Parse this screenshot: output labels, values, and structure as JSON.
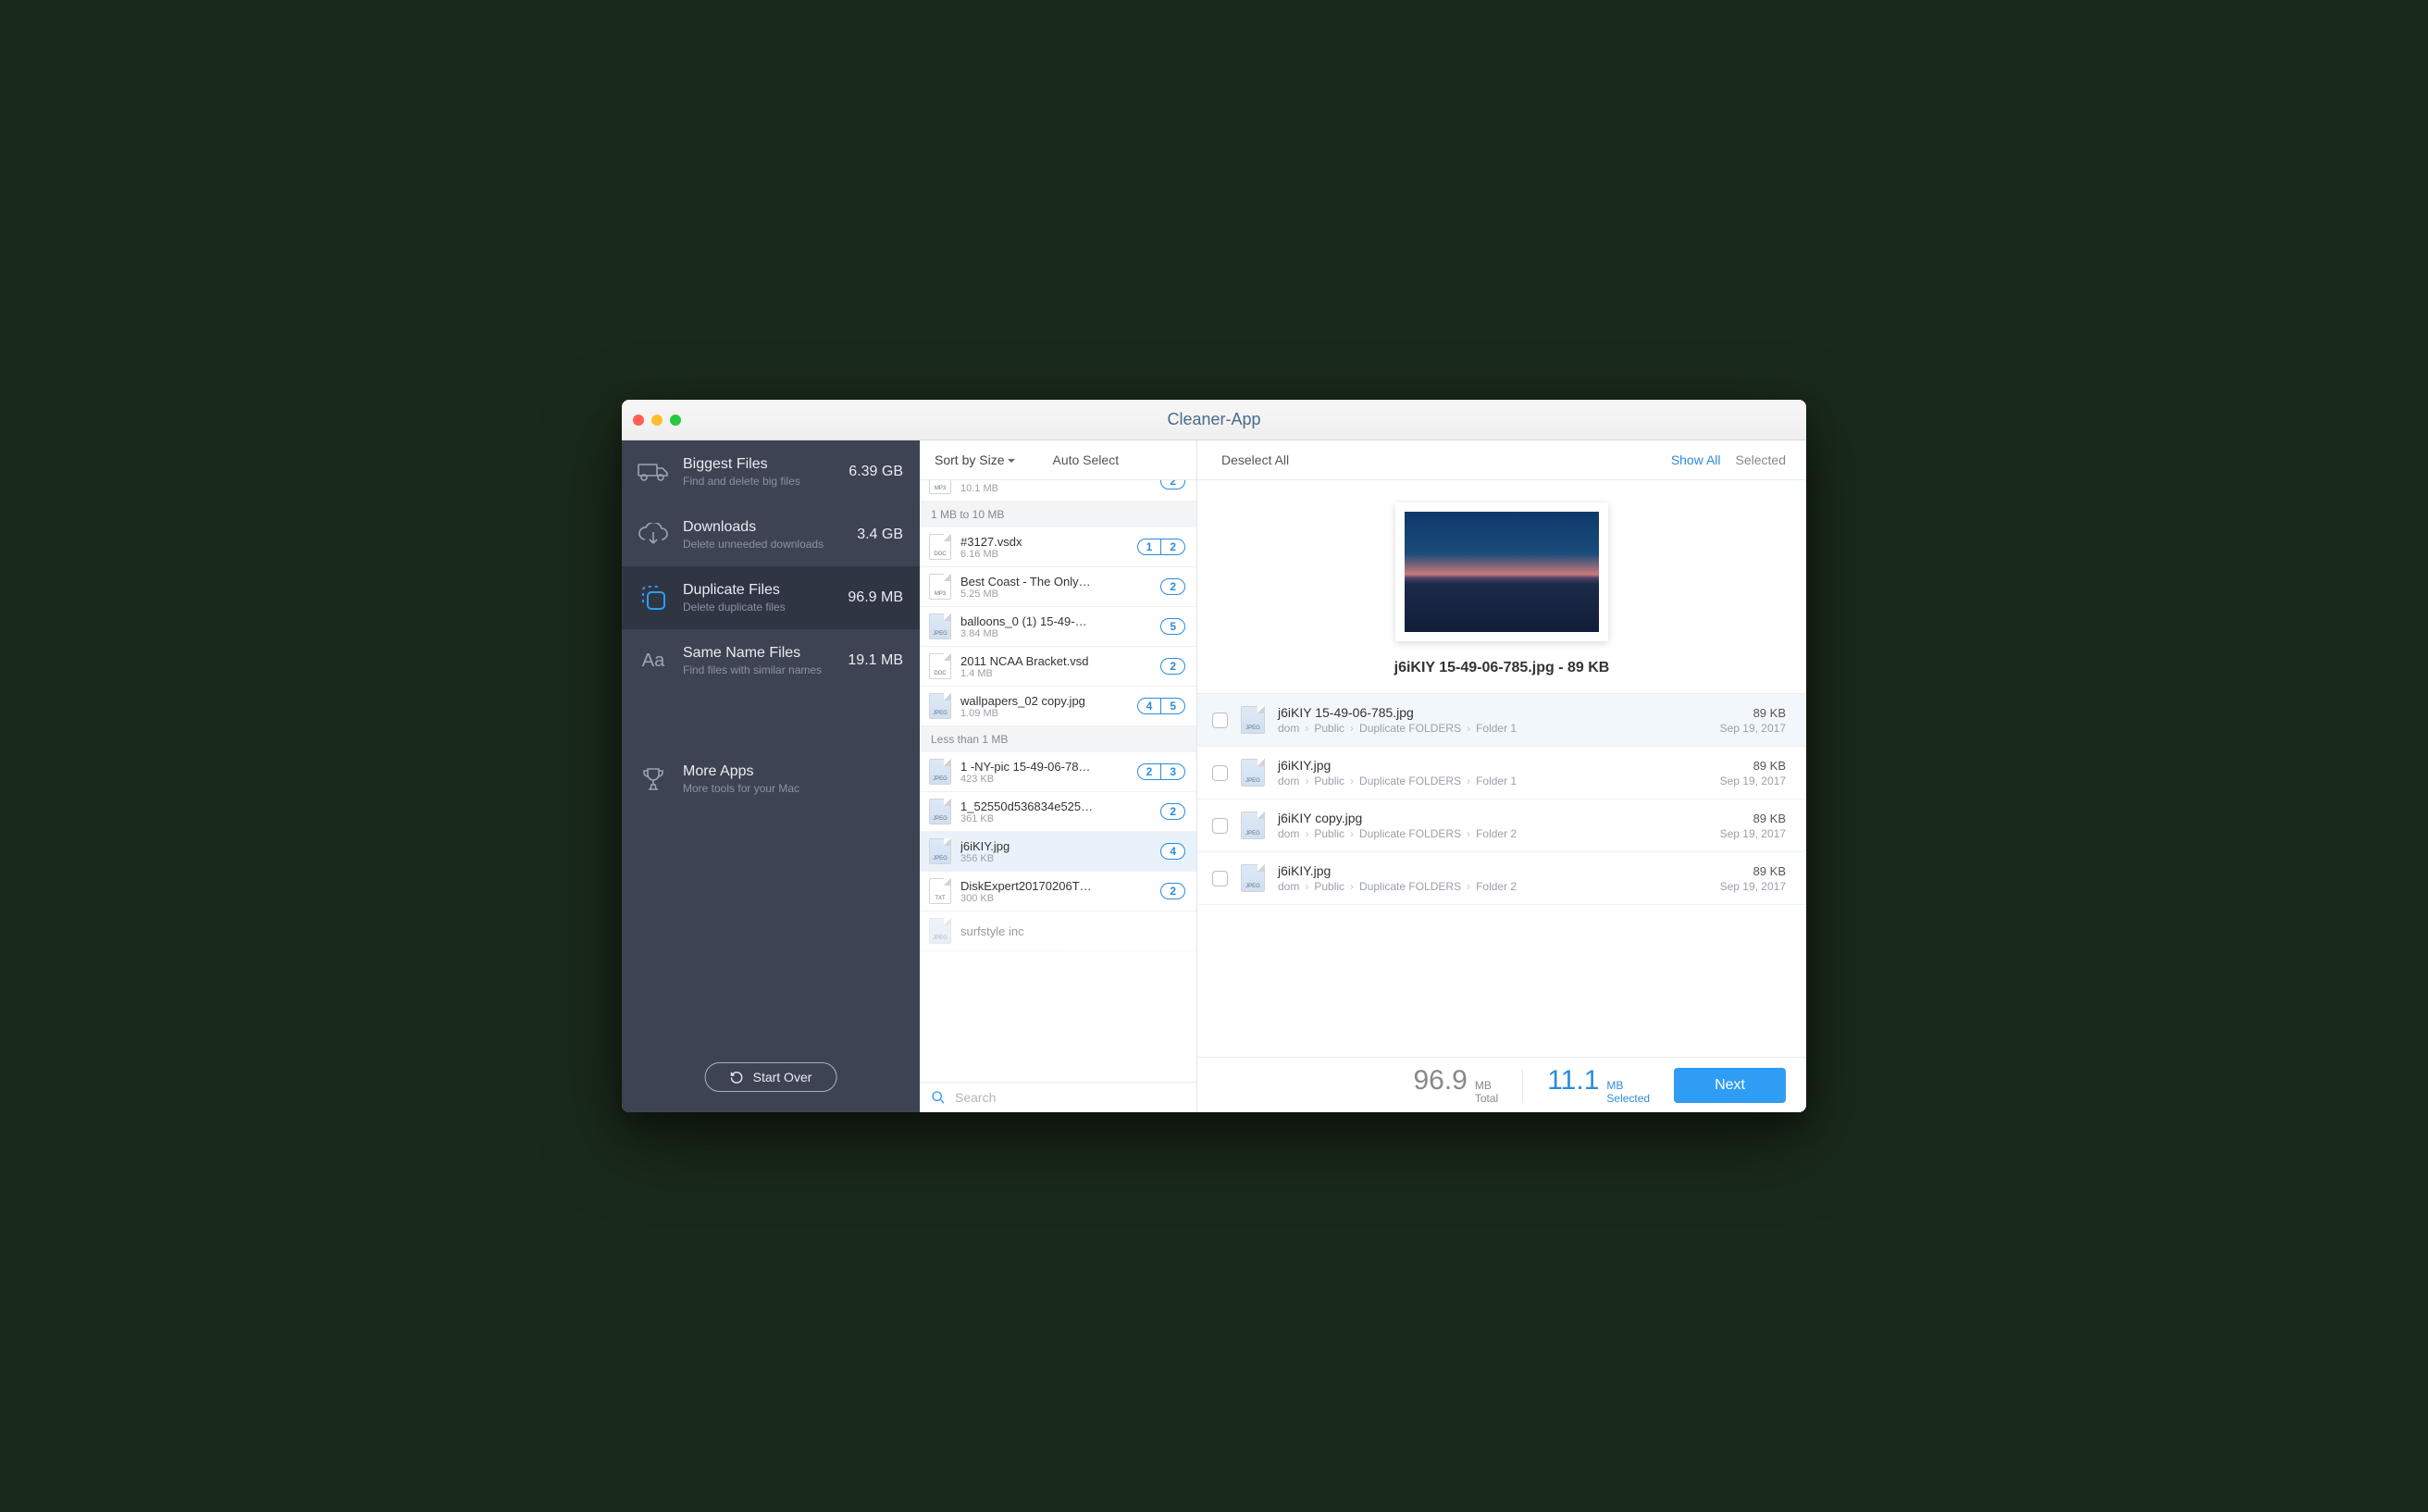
{
  "window": {
    "title": "Cleaner-App"
  },
  "sidebar": {
    "items": [
      {
        "title": "Biggest Files",
        "sub": "Find and delete big files",
        "size": "6.39 GB"
      },
      {
        "title": "Downloads",
        "sub": "Delete unneeded downloads",
        "size": "3.4 GB"
      },
      {
        "title": "Duplicate Files",
        "sub": "Delete duplicate files",
        "size": "96.9 MB"
      },
      {
        "title": "Same Name Files",
        "sub": "Find files with similar names",
        "size": "19.1 MB"
      }
    ],
    "more": {
      "title": "More Apps",
      "sub": "More tools for your Mac"
    },
    "start_over": "Start Over"
  },
  "toolbar": {
    "sort": "Sort by Size",
    "auto": "Auto Select",
    "deselect": "Deselect All",
    "show_all": "Show All",
    "selected": "Selected"
  },
  "filelist": {
    "peek": {
      "size": "10.1 MB"
    },
    "section1": "1 MB to 10 MB",
    "files1": [
      {
        "name": "#3127.vsdx",
        "size": "6.16 MB",
        "badges": [
          "1",
          "2"
        ],
        "type": "doc"
      },
      {
        "name": "Best Coast - The Only…",
        "size": "5.25 MB",
        "badges": [
          "2"
        ],
        "type": "mp3"
      },
      {
        "name": "balloons_0 (1) 15-49-…",
        "size": "3.84 MB",
        "badges": [
          "5"
        ],
        "type": "jpeg"
      },
      {
        "name": "2011 NCAA Bracket.vsd",
        "size": "1.4 MB",
        "badges": [
          "2"
        ],
        "type": "doc"
      },
      {
        "name": "wallpapers_02 copy.jpg",
        "size": "1.09 MB",
        "badges": [
          "4",
          "5"
        ],
        "type": "jpeg"
      }
    ],
    "section2": "Less than 1 MB",
    "files2": [
      {
        "name": "1 -NY-pic 15-49-06-78…",
        "size": "423 KB",
        "badges": [
          "2",
          "3"
        ],
        "type": "jpeg"
      },
      {
        "name": "1_52550d536834e525…",
        "size": "361 KB",
        "badges": [
          "2"
        ],
        "type": "jpeg"
      },
      {
        "name": "j6iKIY.jpg",
        "size": "356 KB",
        "badges": [
          "4"
        ],
        "type": "jpeg"
      },
      {
        "name": "DiskExpert20170206T…",
        "size": "300 KB",
        "badges": [
          "2"
        ],
        "type": "txt"
      }
    ],
    "peek_bottom_name": "surfstyle inc"
  },
  "search": {
    "placeholder": "Search"
  },
  "preview": {
    "title": "j6iKIY 15-49-06-785.jpg - 89 KB"
  },
  "duplicates": [
    {
      "name": "j6iKIY 15-49-06-785.jpg",
      "path": [
        "dom",
        "Public",
        "Duplicate FOLDERS",
        "Folder 1"
      ],
      "size": "89 KB",
      "date": "Sep 19, 2017"
    },
    {
      "name": "j6iKIY.jpg",
      "path": [
        "dom",
        "Public",
        "Duplicate FOLDERS",
        "Folder 1"
      ],
      "size": "89 KB",
      "date": "Sep 19, 2017"
    },
    {
      "name": "j6iKIY copy.jpg",
      "path": [
        "dom",
        "Public",
        "Duplicate FOLDERS",
        "Folder 2"
      ],
      "size": "89 KB",
      "date": "Sep 19, 2017"
    },
    {
      "name": "j6iKIY.jpg",
      "path": [
        "dom",
        "Public",
        "Duplicate FOLDERS",
        "Folder 2"
      ],
      "size": "89 KB",
      "date": "Sep 19, 2017"
    }
  ],
  "footer": {
    "total_num": "96.9",
    "total_unit": "MB",
    "total_label": "Total",
    "sel_num": "11.1",
    "sel_unit": "MB",
    "sel_label": "Selected",
    "next": "Next"
  }
}
